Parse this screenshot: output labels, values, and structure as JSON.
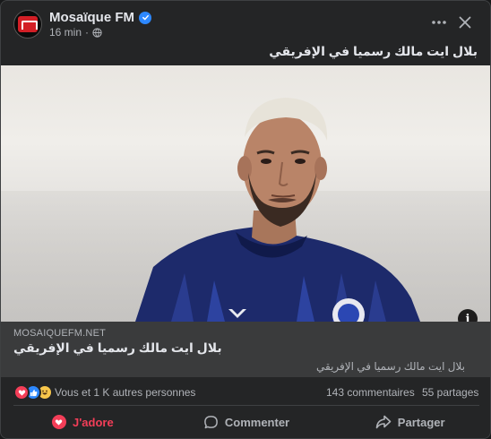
{
  "post": {
    "page_name": "Mosaïque FM",
    "time": "16 min",
    "separator": "·",
    "caption": "بلال ايت مالك رسميا في الإفريقي"
  },
  "link": {
    "domain": "MOSAIQUEFM.NET",
    "title": "بلال ايت مالك رسميا في الإفريقي",
    "description": "بلال ايت مالك رسميا في الإفريقي",
    "info_label": "i"
  },
  "engagement": {
    "reactions_text": "Vous et 1 K autres personnes",
    "comments": "143 commentaires",
    "shares": "55 partages",
    "reaction_icons": [
      "love-icon",
      "like-icon",
      "haha-icon"
    ]
  },
  "actions": {
    "love_label": "J'adore",
    "comment_label": "Commenter",
    "share_label": "Partager"
  },
  "colors": {
    "background": "#242526",
    "accent_love": "#f33e58",
    "verified": "#2d88ff",
    "brand_red": "#d21f26"
  }
}
